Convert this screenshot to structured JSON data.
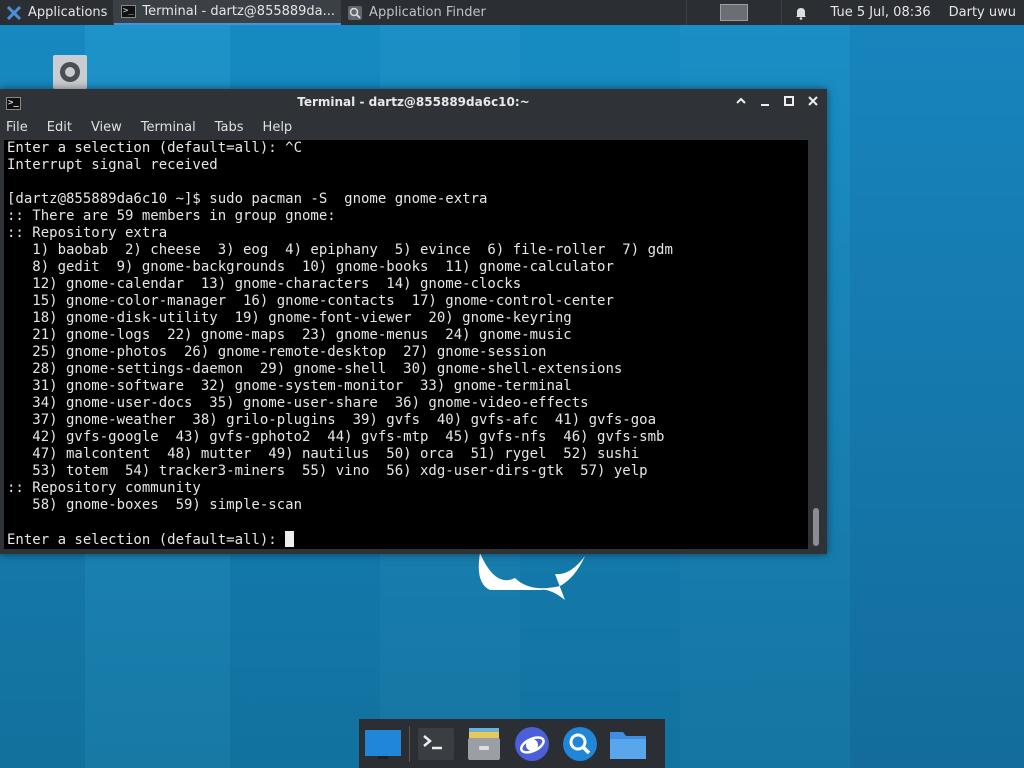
{
  "panel": {
    "applications_label": "Applications",
    "task_terminal": "Terminal - dartz@855889da...",
    "task_finder": "Application Finder",
    "clock": "Tue  5 Jul, 08:36",
    "user": "Darty uwu"
  },
  "window": {
    "title": "Terminal - dartz@855889da6c10:~",
    "menu": [
      "File",
      "Edit",
      "View",
      "Terminal",
      "Tabs",
      "Help"
    ]
  },
  "terminal": {
    "lines": [
      "Enter a selection (default=all): ^C",
      "Interrupt signal received",
      "",
      "[dartz@855889da6c10 ~]$ sudo pacman -S  gnome gnome-extra",
      ":: There are 59 members in group gnome:",
      ":: Repository extra",
      "   1) baobab  2) cheese  3) eog  4) epiphany  5) evince  6) file-roller  7) gdm",
      "   8) gedit  9) gnome-backgrounds  10) gnome-books  11) gnome-calculator",
      "   12) gnome-calendar  13) gnome-characters  14) gnome-clocks",
      "   15) gnome-color-manager  16) gnome-contacts  17) gnome-control-center",
      "   18) gnome-disk-utility  19) gnome-font-viewer  20) gnome-keyring",
      "   21) gnome-logs  22) gnome-maps  23) gnome-menus  24) gnome-music",
      "   25) gnome-photos  26) gnome-remote-desktop  27) gnome-session",
      "   28) gnome-settings-daemon  29) gnome-shell  30) gnome-shell-extensions",
      "   31) gnome-software  32) gnome-system-monitor  33) gnome-terminal",
      "   34) gnome-user-docs  35) gnome-user-share  36) gnome-video-effects",
      "   37) gnome-weather  38) grilo-plugins  39) gvfs  40) gvfs-afc  41) gvfs-goa",
      "   42) gvfs-google  43) gvfs-gphoto2  44) gvfs-mtp  45) gvfs-nfs  46) gvfs-smb",
      "   47) malcontent  48) mutter  49) nautilus  50) orca  51) rygel  52) sushi",
      "   53) totem  54) tracker3-miners  55) vino  56) xdg-user-dirs-gtk  57) yelp",
      ":: Repository community",
      "   58) gnome-boxes  59) simple-scan",
      ""
    ],
    "prompt": "Enter a selection (default=all): "
  },
  "colors": {
    "panel_bg": "#2b2e33",
    "desktop_bg": "#1789c0",
    "accent": "#4b8fd8"
  },
  "dock_icons": [
    "show-desktop-icon",
    "terminal-icon",
    "file-cabinet-icon",
    "web-browser-icon",
    "app-finder-icon",
    "folder-icon"
  ]
}
